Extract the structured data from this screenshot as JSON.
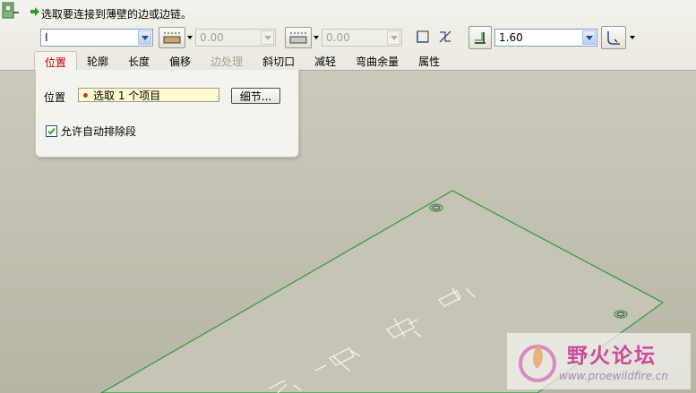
{
  "prompt": {
    "text": "选取要连接到薄壁的边或边链。"
  },
  "toolbar": {
    "shape_select": {
      "value": "I"
    },
    "offset1": {
      "value": "0.00"
    },
    "offset2": {
      "value": "0.00"
    },
    "thickness": {
      "value": "1.60"
    }
  },
  "tabs": [
    {
      "label": "位置",
      "state": "active"
    },
    {
      "label": "轮廓",
      "state": "normal"
    },
    {
      "label": "长度",
      "state": "normal"
    },
    {
      "label": "偏移",
      "state": "normal"
    },
    {
      "label": "边处理",
      "state": "disabled"
    },
    {
      "label": "斜切口",
      "state": "normal"
    },
    {
      "label": "减轻",
      "state": "normal"
    },
    {
      "label": "弯曲余量",
      "state": "normal"
    },
    {
      "label": "属性",
      "state": "normal"
    }
  ],
  "panel": {
    "position_label": "位置",
    "collector_text": "选取 1 个项目",
    "details_button": "细节...",
    "auto_exclude_label": "允许自动排除段",
    "auto_exclude_checked": true
  },
  "watermark": {
    "title": "野火论坛",
    "url": "www.proewildfire.cn"
  },
  "colors": {
    "model_edge": "#2e9a3a",
    "background": "#bdbcaf",
    "active_tab": "#c00000"
  }
}
